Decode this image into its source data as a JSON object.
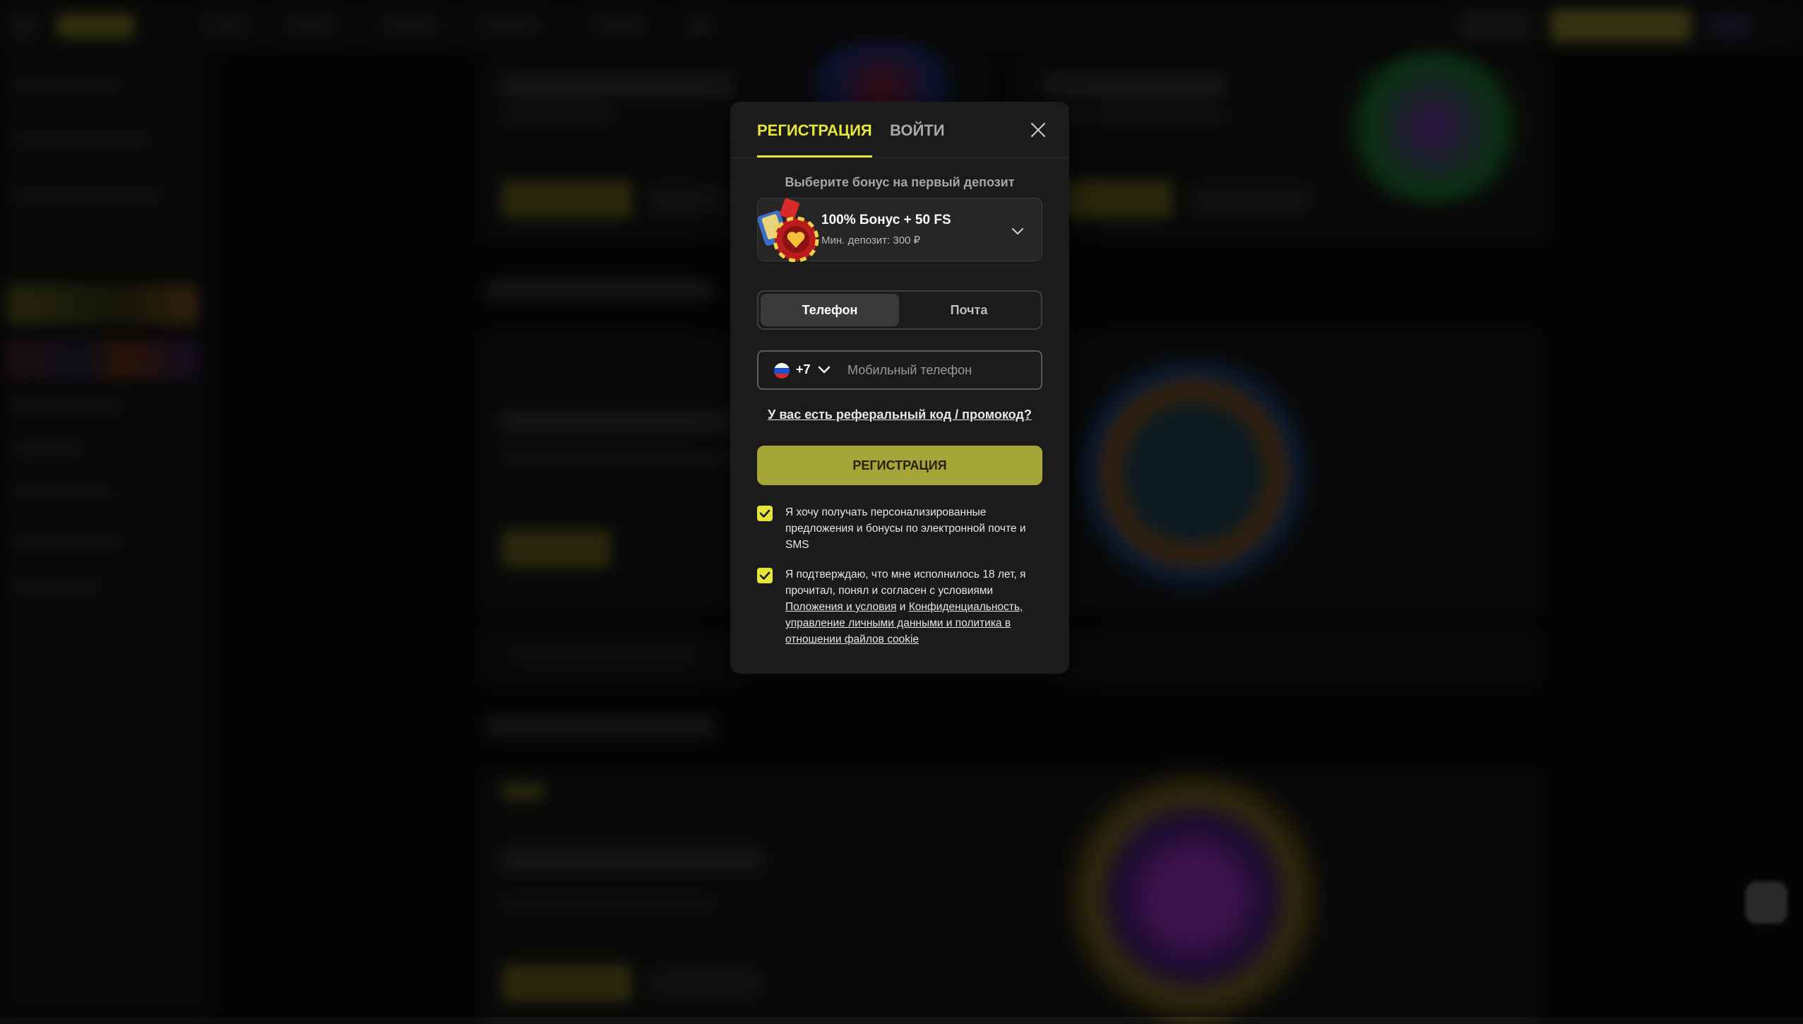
{
  "modal": {
    "tabs": {
      "register": "РЕГИСТРАЦИЯ",
      "login": "ВОЙТИ"
    },
    "bonus": {
      "heading": "Выберите бонус на первый депозит",
      "selected_title": "100% Бонус + 50 FS",
      "selected_min": "Мин. депозит: 300 ₽"
    },
    "method_tabs": {
      "phone": "Телефон",
      "email": "Почта",
      "active": "phone"
    },
    "phone": {
      "country_code": "+7",
      "placeholder": "Мобильный телефон",
      "value": ""
    },
    "promo_link": "У вас есть реферальный код / промокод?",
    "submit_label": "РЕГИСТРАЦИЯ",
    "consents": {
      "marketing": {
        "checked": true,
        "text": "Я хочу получать персонализированные предложения и бонусы по электронной почте и SMS"
      },
      "age": {
        "checked": true,
        "text_before": "Я подтверждаю, что мне исполнилось 18 лет, я прочитал, понял и согласен с условиями ",
        "terms_link": "Положения и условия",
        "and": " и ",
        "privacy_link": "Конфиденциальность, управление личными данными и политика в отношении файлов cookie"
      }
    }
  },
  "colors": {
    "accent": "#e6e63a",
    "button": "#a5a53a",
    "modal_bg": "#1b1b1b"
  },
  "icons": {
    "close": "close-icon",
    "chevron": "chevron-down-icon",
    "flag": "russia-flag-icon",
    "check": "checkmark-icon"
  }
}
